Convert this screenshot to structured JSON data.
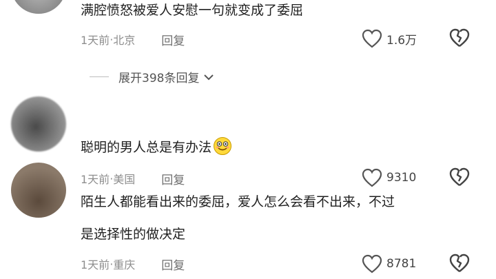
{
  "comments": [
    {
      "text": "满腔愤怒被爱人安慰一句就变成了委屈",
      "time": "1天前",
      "location": "北京",
      "reply_label": "回复",
      "likes": "1.6万",
      "expand_label": "展开398条回复"
    },
    {
      "text": "聪明的男人总是有办法",
      "emoji": "grinning-face-emoji",
      "time": "1天前",
      "location": "美国",
      "reply_label": "回复",
      "likes": "9310"
    },
    {
      "text_line1": "陌生人都能看出来的委屈，爱人怎么会看不出来，不过",
      "text_line2": "是选择性的做决定",
      "time": "1天前",
      "location": "重庆",
      "reply_label": "回复",
      "likes": "8781"
    }
  ],
  "separator": " · ",
  "icons": {
    "like": "heart-outline-icon",
    "dislike": "broken-heart-icon",
    "expand": "chevron-down-icon"
  },
  "colors": {
    "text": "#1f1f1f",
    "meta": "#8e8e8e",
    "icon": "#555555"
  }
}
